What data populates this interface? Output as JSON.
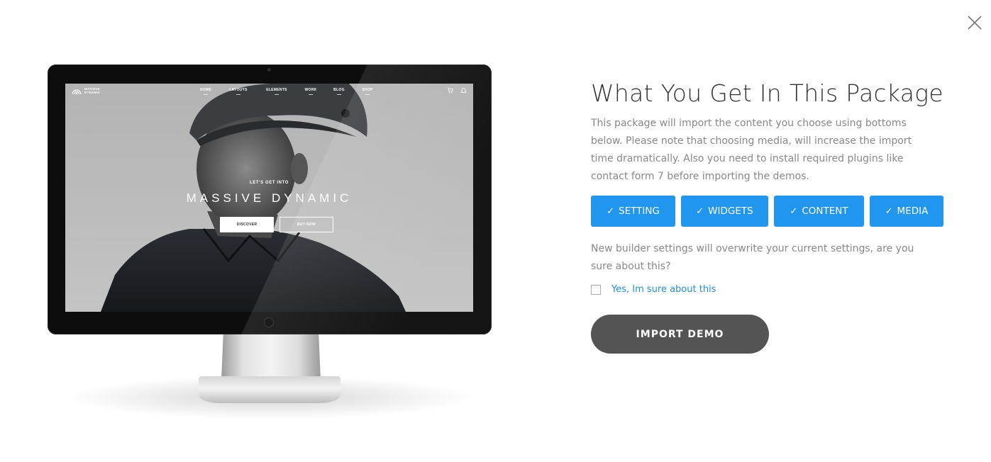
{
  "modal": {
    "close_icon": "close-icon"
  },
  "preview": {
    "site": {
      "logo_text": "MASSIVE DYNAMIC",
      "menu": [
        "HOME",
        "LAYOUTS",
        "ELEMENTS",
        "WORK",
        "BLOG",
        "SHOP"
      ],
      "icons": [
        "cart-icon",
        "bell-icon"
      ],
      "kicker": "LET'S GET INTO",
      "hero_title": "MASSIVE DYNAMIC",
      "buttons": [
        "DISCOVER",
        "BUY NOW"
      ]
    }
  },
  "panel": {
    "title": "What You Get In This Package",
    "description": "This package will import the content you choose using bottoms below. Please note that choosing media, will increase the import time dramatically. Also you need to install required plugins like contact form 7 before importing the demos.",
    "options": [
      {
        "label": "SETTING",
        "checked": true
      },
      {
        "label": "WIDGETS",
        "checked": true
      },
      {
        "label": "CONTENT",
        "checked": true
      },
      {
        "label": "MEDIA",
        "checked": true
      }
    ],
    "warning": "New builder settings will overwrite your current settings, are you sure about this?",
    "confirm_label": "Yes, Im sure about this",
    "import_label": "IMPORT DEMO"
  },
  "colors": {
    "accent": "#2196ef",
    "link": "#1e8fdc",
    "button_dark": "#545454"
  }
}
